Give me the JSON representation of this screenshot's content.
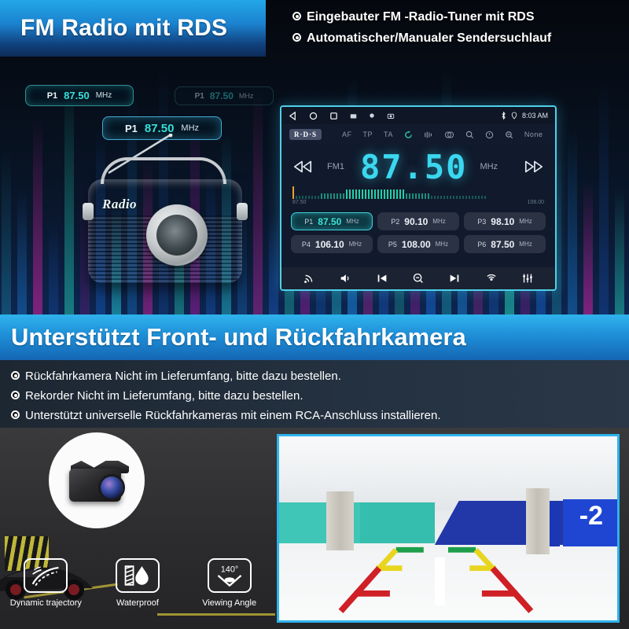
{
  "section_fm": {
    "banner_title": "FM Radio mit RDS",
    "bullets": [
      "Eingebauter FM -Radio-Tuner mit RDS",
      "Automatischer/Manualer Sendersuchlauf"
    ],
    "floating_chips": [
      {
        "preset": "P1",
        "freq": "87.50",
        "unit": "MHz"
      },
      {
        "preset": "P1",
        "freq": "87.50",
        "unit": "MHz"
      },
      {
        "preset": "P1",
        "freq": "87.50",
        "unit": "MHz"
      }
    ],
    "vintage_radio": {
      "brand_script": "Radio"
    },
    "head_unit": {
      "status": {
        "time": "8:03 AM",
        "bluetooth_icon": "bluetooth-icon",
        "location_icon": "location-pin-icon"
      },
      "nav_icons": [
        "back-triangle-icon",
        "home-circle-icon",
        "recents-square-icon",
        "gallery-icon",
        "record-icon",
        "screenshot-icon"
      ],
      "rds": {
        "badge": "R·D·S",
        "items": [
          "AF",
          "TP",
          "TA"
        ],
        "icons": [
          "loop-icon",
          "signal-waves-icon",
          "stereo-icon",
          "search-icon",
          "info-icon",
          "scan-icon"
        ],
        "pty": "None"
      },
      "tuner": {
        "band": "FM1",
        "frequency": "87.50",
        "unit": "MHz",
        "prev_icon": "rewind-icon",
        "next_icon": "fast-forward-icon",
        "scale_min": "87.50",
        "scale_max": "108.00"
      },
      "presets": [
        {
          "name": "P1",
          "freq": "87.50",
          "unit": "MHz",
          "active": true
        },
        {
          "name": "P2",
          "freq": "90.10",
          "unit": "MHz",
          "active": false
        },
        {
          "name": "P3",
          "freq": "98.10",
          "unit": "MHz",
          "active": false
        },
        {
          "name": "P4",
          "freq": "106.10",
          "unit": "MHz",
          "active": false
        },
        {
          "name": "P5",
          "freq": "108.00",
          "unit": "MHz",
          "active": false
        },
        {
          "name": "P6",
          "freq": "87.50",
          "unit": "MHz",
          "active": false
        }
      ],
      "toolbar_icons": [
        "radio-antenna-icon",
        "volume-icon",
        "previous-track-icon",
        "scan-down-icon",
        "next-track-icon",
        "broadcast-icon",
        "equalizer-icon"
      ]
    }
  },
  "section_camera": {
    "banner_title": "Unterstützt Front- und Rückfahrkamera",
    "bullets": [
      "Rückfahrkamera Nicht im Lieferumfang, bitte dazu bestellen.",
      "Rekorder Nicht im Lieferumfang, bitte dazu bestellen.",
      "Unterstützt universelle Rückfahrkameras mit einem RCA-Anschluss installieren."
    ],
    "features": [
      {
        "label": "Dynamic trajectory",
        "icon": "trajectory-icon"
      },
      {
        "label": "Waterproof",
        "icon": "water-drop-icon"
      },
      {
        "label": "Viewing Angle",
        "icon": "viewing-angle-icon",
        "value": "140°"
      }
    ],
    "garage_preview": {
      "level_sign": "-2"
    }
  },
  "colors": {
    "accent_cyan": "#3ad8f0",
    "banner_blue": "#1f8fd8",
    "preset_active": "#3fe4d6",
    "guide_green": "#1e9e4a",
    "guide_yellow": "#e8d51f",
    "guide_red": "#cf2026",
    "radio_teal": "#36c4a8"
  }
}
